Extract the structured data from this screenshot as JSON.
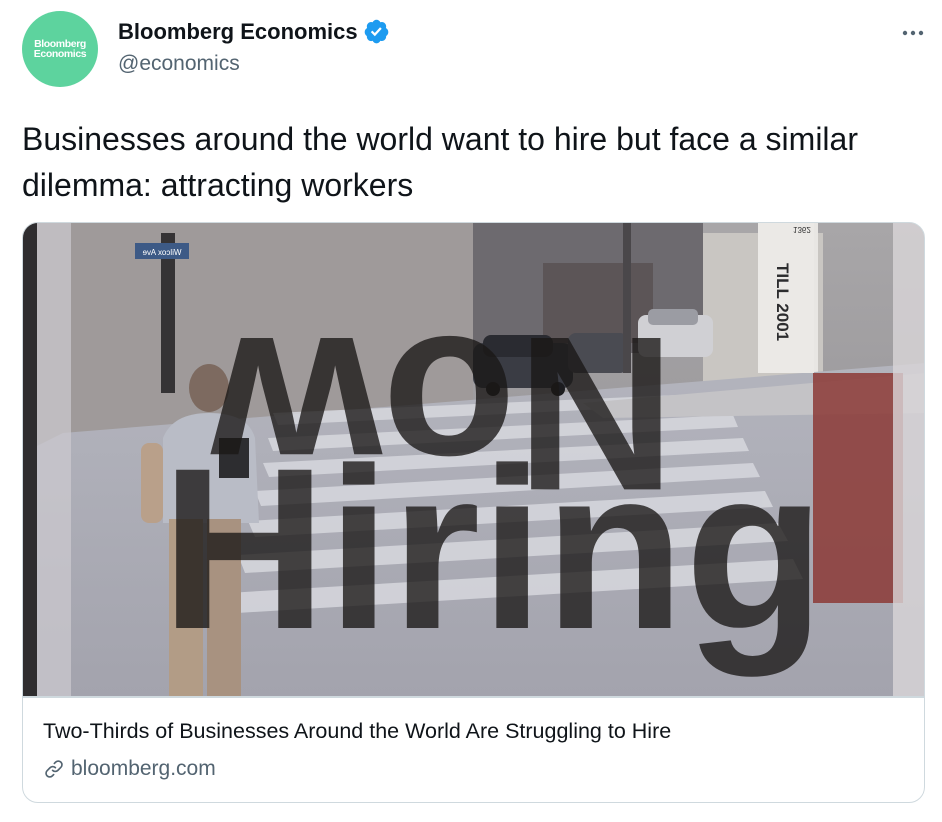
{
  "author": {
    "avatar_line1": "Bloomberg",
    "avatar_line2": "Economics",
    "avatar_color": "#5dd39e",
    "display_name": "Bloomberg Economics",
    "handle": "@economics",
    "verified": true,
    "verified_icon": "verified-badge-icon",
    "verified_color": "#1d9bf0"
  },
  "menu": {
    "icon": "more-horizontal-icon"
  },
  "tweet": {
    "text": "Businesses around the world want to hire but face a similar dilemma: attracting workers"
  },
  "card": {
    "image_text_line1": "Now",
    "image_text_line2": "Hiring",
    "street_sign": "Wilcox Ave",
    "building_sign": "TILL 2001",
    "building_number": "1362",
    "title": "Two-Thirds of Businesses Around the World Are Struggling to Hire",
    "domain": "bloomberg.com",
    "link_icon": "link-icon"
  }
}
